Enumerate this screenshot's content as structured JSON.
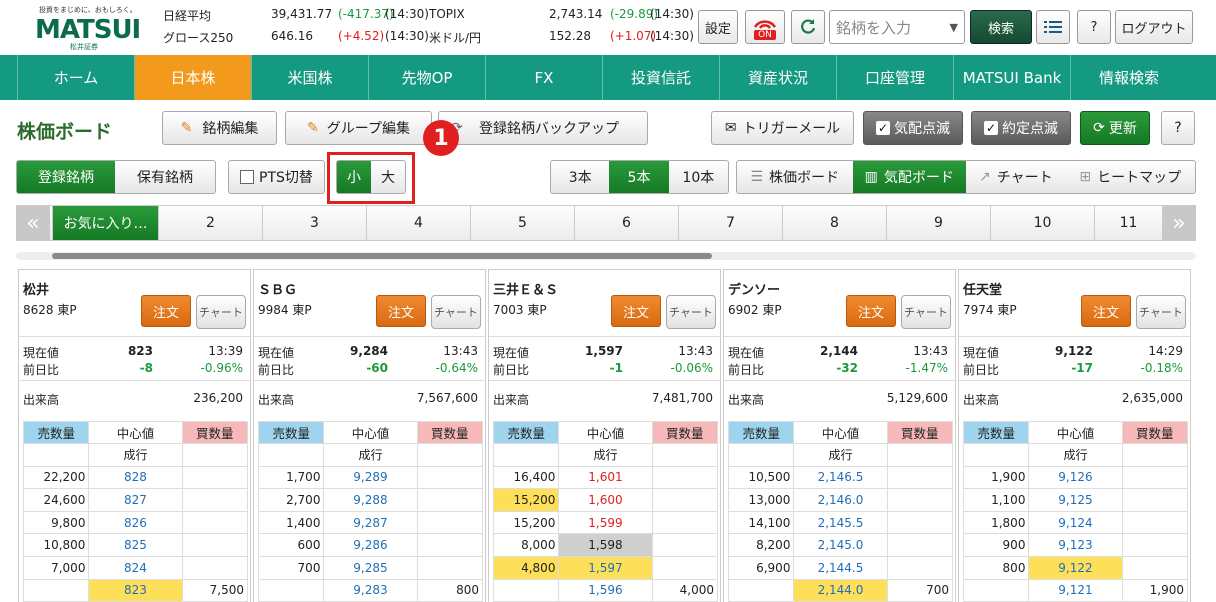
{
  "header": {
    "logo_tagline": "投資をまじめに、おもしろく。",
    "logo_name": "MATSUI",
    "logo_sub": "松井証券",
    "markets": [
      {
        "name": "日経平均",
        "value": "39,431.77",
        "change": "(-417.37)",
        "time": "(14:30)",
        "dir": "dn"
      },
      {
        "name": "グロース250",
        "value": "646.16",
        "change": "(+4.52)",
        "time": "(14:30)",
        "dir": "up"
      },
      {
        "name": "TOPIX",
        "value": "2,743.14",
        "change": "(-29.89)",
        "time": "(14:30)",
        "dir": "dn"
      },
      {
        "name": "米ドル/円",
        "value": "152.28",
        "change": "(+1.07)",
        "time": "(14:30)",
        "dir": "up"
      }
    ],
    "settings_label": "設定",
    "power_label": "ON",
    "search_placeholder": "銘柄を入力",
    "search_button": "検索",
    "help_label": "?",
    "logout_label": "ログアウト"
  },
  "nav": [
    "ホーム",
    "日本株",
    "米国株",
    "先物OP",
    "FX",
    "投資信託",
    "資産状況",
    "口座管理",
    "MATSUI Bank",
    "情報検索"
  ],
  "toolbar": {
    "title": "株価ボード",
    "edit_stocks": "銘柄編集",
    "edit_groups": "グループ編集",
    "backup": "登録銘柄バックアップ",
    "trigger_mail": "トリガーメール",
    "quote_blink": "気配点滅",
    "trade_blink": "約定点滅",
    "refresh": "更新",
    "help": "?"
  },
  "controls": {
    "registered": "登録銘柄",
    "holdings": "保有銘柄",
    "pts": "PTS切替",
    "small": "小",
    "large": "大",
    "badge": "1",
    "rows": [
      "3本",
      "5本",
      "10本"
    ],
    "views": [
      "株価ボード",
      "気配ボード",
      "チャート",
      "ヒートマップ"
    ]
  },
  "groups": [
    "お気に入り…",
    "2",
    "3",
    "4",
    "5",
    "6",
    "7",
    "8",
    "9",
    "10",
    "11"
  ],
  "cards": [
    {
      "name": "松井",
      "code": "8628 東P",
      "order": "注文",
      "chart": "チャート",
      "price": "823",
      "time": "13:39",
      "chg": "-8",
      "pct": "-0.96%",
      "vol": "236,200",
      "sell": [
        "",
        "22,200",
        "24,600",
        "9,800",
        "10,800",
        "7,000",
        ""
      ],
      "mid": [
        "成行",
        "828",
        "827",
        "826",
        "825",
        "824",
        "823"
      ],
      "buy": [
        "",
        "",
        "",
        "",
        "",
        "",
        "7,500"
      ],
      "hl_mid": 6
    },
    {
      "name": "ＳＢＧ",
      "code": "9984 東P",
      "order": "注文",
      "chart": "チャート",
      "price": "9,284",
      "time": "13:43",
      "chg": "-60",
      "pct": "-0.64%",
      "vol": "7,567,600",
      "sell": [
        "",
        "1,700",
        "2,700",
        "1,400",
        "600",
        "700",
        ""
      ],
      "mid": [
        "成行",
        "9,289",
        "9,288",
        "9,287",
        "9,286",
        "9,285",
        "9,283"
      ],
      "buy": [
        "",
        "",
        "",
        "",
        "",
        "",
        "800"
      ],
      "hl_mid": -1
    },
    {
      "name": "三井Ｅ＆Ｓ",
      "code": "7003 東P",
      "order": "注文",
      "chart": "チャート",
      "price": "1,597",
      "time": "13:43",
      "chg": "-1",
      "pct": "-0.06%",
      "vol": "7,481,700",
      "sell": [
        "",
        "16,400",
        "15,200",
        "15,200",
        "8,000",
        "4,800",
        ""
      ],
      "mid": [
        "成行",
        "1,601",
        "1,600",
        "1,599",
        "1,598",
        "1,597",
        "1,596"
      ],
      "buy": [
        "",
        "",
        "",
        "",
        "",
        "",
        "4,000"
      ],
      "hl_mid": 5
    },
    {
      "name": "デンソー",
      "code": "6902 東P",
      "order": "注文",
      "chart": "チャート",
      "price": "2,144",
      "time": "13:43",
      "chg": "-32",
      "pct": "-1.47%",
      "vol": "5,129,600",
      "sell": [
        "",
        "10,500",
        "13,000",
        "14,100",
        "8,200",
        "6,900",
        ""
      ],
      "mid": [
        "成行",
        "2,146.5",
        "2,146.0",
        "2,145.5",
        "2,145.0",
        "2,144.5",
        "2,144.0"
      ],
      "buy": [
        "",
        "",
        "",
        "",
        "",
        "",
        "700"
      ],
      "hl_mid": 6
    },
    {
      "name": "任天堂",
      "code": "7974 東P",
      "order": "注文",
      "chart": "チャート",
      "price": "9,122",
      "time": "14:29",
      "chg": "-17",
      "pct": "-0.18%",
      "vol": "2,635,000",
      "sell": [
        "",
        "1,900",
        "1,100",
        "1,800",
        "900",
        "800",
        ""
      ],
      "mid": [
        "成行",
        "9,126",
        "9,125",
        "9,124",
        "9,123",
        "9,122",
        "9,121"
      ],
      "buy": [
        "",
        "",
        "",
        "",
        "",
        "",
        "1,900"
      ],
      "hl_mid": 5
    }
  ],
  "labels": {
    "cur": "現在値",
    "prev": "前日比",
    "vol": "出来高",
    "sell": "売数量",
    "center": "中心値",
    "buy": "買数量"
  }
}
